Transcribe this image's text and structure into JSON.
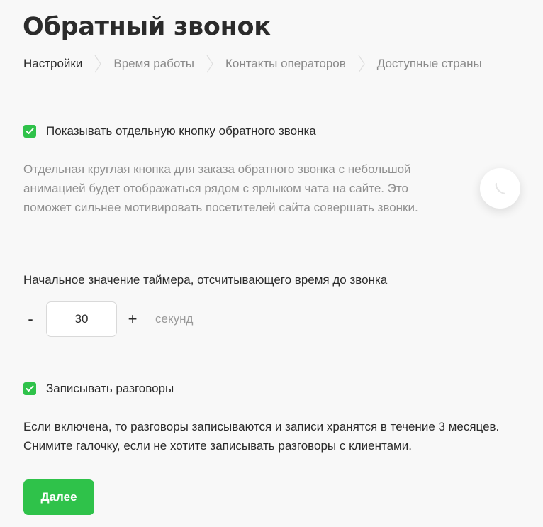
{
  "page": {
    "title": "Обратный звонок"
  },
  "steps": [
    {
      "label": "Настройки",
      "active": true
    },
    {
      "label": "Время работы",
      "active": false
    },
    {
      "label": "Контакты операторов",
      "active": false
    },
    {
      "label": "Доступные страны",
      "active": false
    }
  ],
  "callback_button": {
    "checked": true,
    "label": "Показывать отдельную кнопку обратного звонка",
    "description": "Отдельная круглая кнопка для заказа обратного звонка с небольшой анимацией будет отображаться рядом с ярлыком чата на сайте. Это поможет сильнее мотивировать посетителей сайта совершать звонки.",
    "preview_icon": "phone-icon"
  },
  "timer": {
    "label": "Начальное значение таймера, отсчитывающего время до звонка",
    "decrement": "-",
    "value": "30",
    "increment": "+",
    "unit": "секунд"
  },
  "recording": {
    "checked": true,
    "label": "Записывать разговоры",
    "description_line1": "Если включена, то разговоры записываются и записи хранятся в течение 3 месяцев.",
    "description_line2": "Снимите галочку, если не хотите записывать разговоры с клиентами."
  },
  "actions": {
    "next_label": "Далее"
  },
  "colors": {
    "accent": "#2fc24a",
    "text": "#2b2b2b",
    "muted": "#8f8f8f",
    "background": "#f8f8f8"
  }
}
